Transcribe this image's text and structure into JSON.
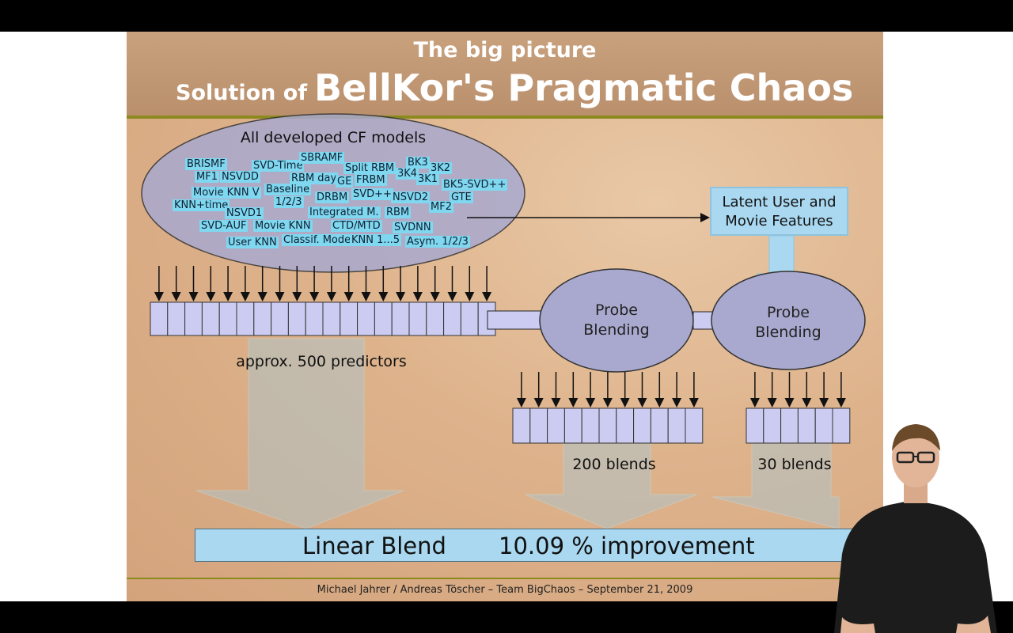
{
  "slide": {
    "title_small": "The big picture",
    "title_prefix": "Solution of",
    "title_main": "BellKor's Pragmatic Chaos",
    "ellipse_title": "All developed CF models",
    "models": [
      "BRISMF",
      "SVD-Time",
      "SBRAMF",
      "Split RBM",
      "BK3",
      "3K2",
      "MF1",
      "NSVDD",
      "RBM day",
      "GE",
      "FRBM",
      "3K4",
      "3K1",
      "BK5-SVD++",
      "Movie KNN V",
      "Baseline",
      "1/2/3",
      "DRBM",
      "SVD++",
      "NSVD2",
      "GTE",
      "KNN+time",
      "NSVD1",
      "Integrated M.",
      "RBM",
      "MF2",
      "SVD-AUF",
      "Movie KNN",
      "CTD/MTD",
      "SVDNN",
      "User KNN",
      "Classif. Mode",
      "KNN 1...5",
      "Asym. 1/2/3"
    ],
    "latent_box": [
      "Latent User and",
      "Movie Features"
    ],
    "probe_blend_1": [
      "Probe",
      "Blending"
    ],
    "probe_blend_2": [
      "Probe",
      "Blending"
    ],
    "predictors_label": "approx. 500 predictors",
    "blends_200_label": "200 blends",
    "blends_30_label": "30 blends",
    "linear_blend_label": "Linear Blend",
    "improvement_label": "10.09 % improvement",
    "footer": "Michael Jahrer / Andreas Töscher  –  Team BigChaos  –  September 21, 2009"
  },
  "colors": {
    "cell_fill": "#ccccf2",
    "ellipse_fill": "#a9a9cf",
    "model_label_bg": "#7fd7f0",
    "big_arrow_fill": "#a6c8d6",
    "rule": "#8c8a1e"
  }
}
